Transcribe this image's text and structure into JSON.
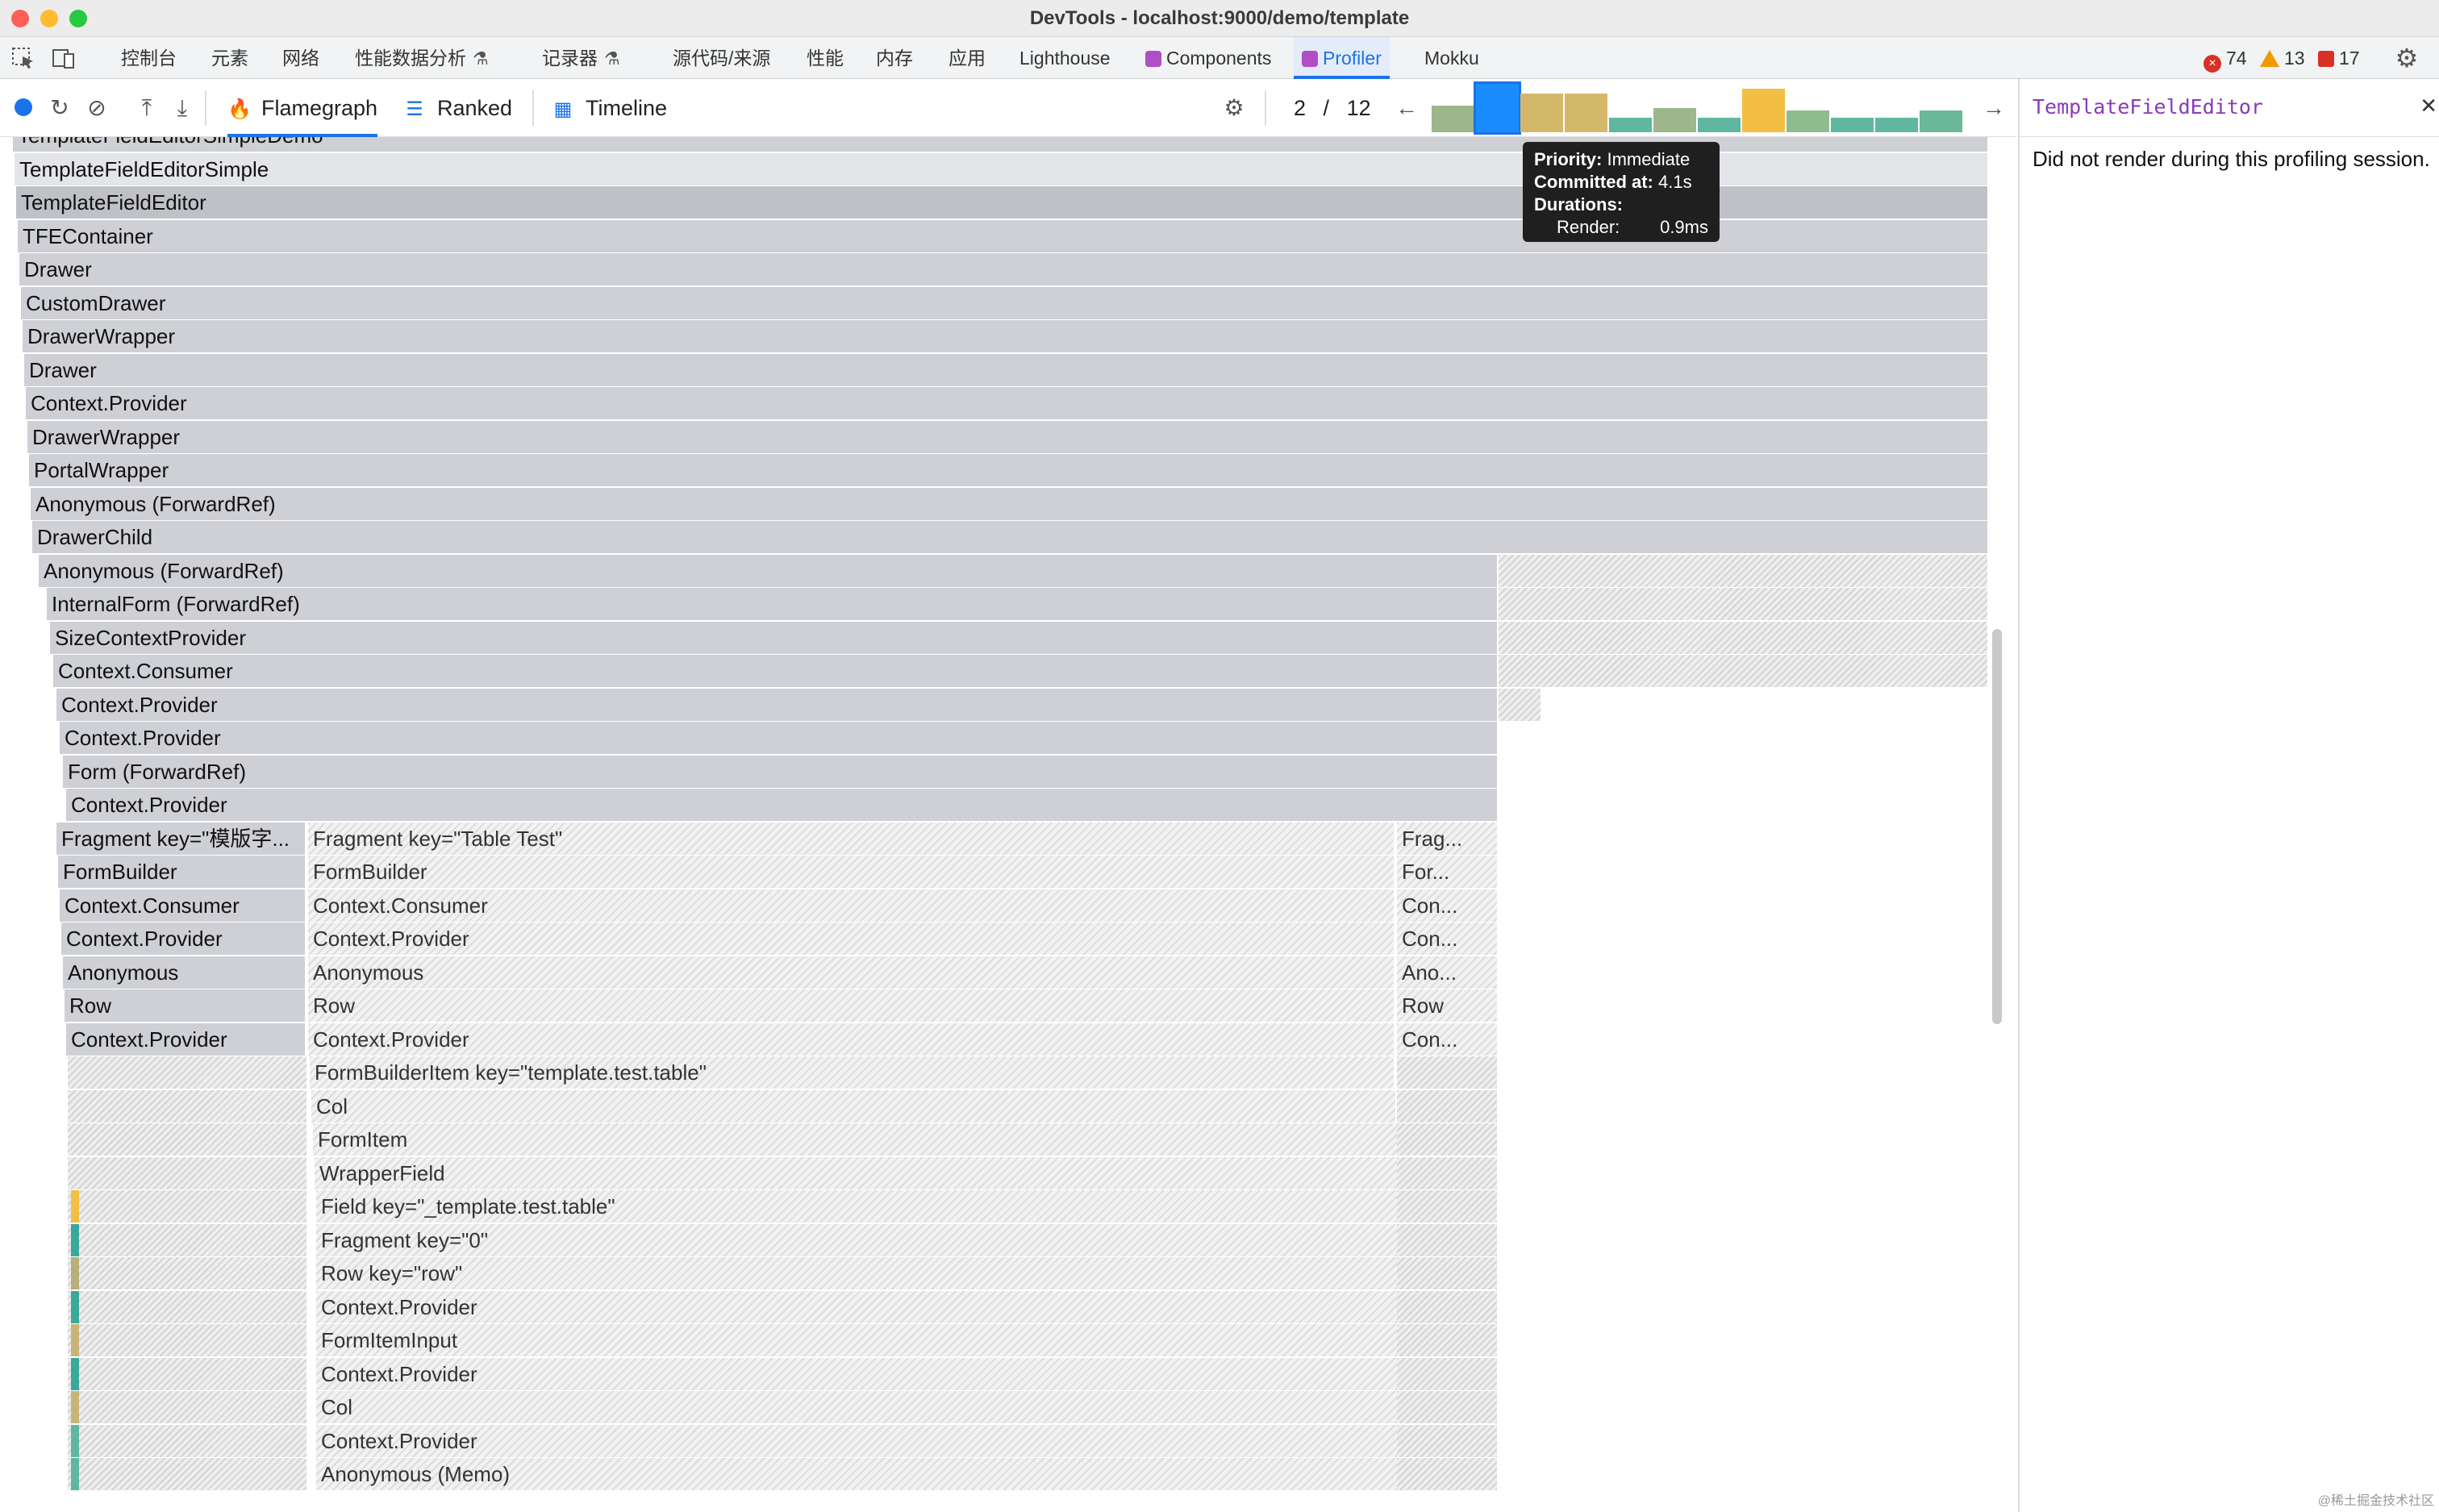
{
  "window": {
    "title": "DevTools - localhost:9000/demo/template"
  },
  "devtools_tabs": [
    {
      "label": "控制台"
    },
    {
      "label": "元素"
    },
    {
      "label": "网络"
    },
    {
      "label": "性能数据分析",
      "flask": "⚗"
    },
    {
      "label": "记录器",
      "flask": "⚗"
    },
    {
      "label": "源代码/来源"
    },
    {
      "label": "性能"
    },
    {
      "label": "内存"
    },
    {
      "label": "应用"
    },
    {
      "label": "Lighthouse"
    },
    {
      "label": "Components"
    },
    {
      "label": "Profiler"
    },
    {
      "label": "Mokku"
    }
  ],
  "counters": {
    "errors": "74",
    "warnings": "13",
    "issues": "17"
  },
  "profiler": {
    "modes": {
      "flamegraph": "Flamegraph",
      "ranked": "Ranked",
      "timeline": "Timeline"
    },
    "commit": {
      "current": "2",
      "separator": "/",
      "total": "12"
    },
    "commit_bars": [
      {
        "h": 0.55,
        "color": "#9db68a"
      },
      {
        "h": 1.0,
        "color": "#1a8cff",
        "selected": true
      },
      {
        "h": 0.8,
        "color": "#d4b86a"
      },
      {
        "h": 0.8,
        "color": "#d4b86a"
      },
      {
        "h": 0.3,
        "color": "#5fb7a0"
      },
      {
        "h": 0.5,
        "color": "#9db68a"
      },
      {
        "h": 0.3,
        "color": "#5fb7a0"
      },
      {
        "h": 0.9,
        "color": "#f2bf44"
      },
      {
        "h": 0.45,
        "color": "#8fbc8f"
      },
      {
        "h": 0.3,
        "color": "#5fb7a0"
      },
      {
        "h": 0.3,
        "color": "#5fb7a0"
      },
      {
        "h": 0.45,
        "color": "#6cb89a"
      }
    ]
  },
  "tooltip": {
    "priority_label": "Priority:",
    "priority_value": "Immediate",
    "committed_label": "Committed at:",
    "committed_value": "4.1s",
    "durations_label": "Durations:",
    "render_label": "Render:",
    "render_value": "0.9ms"
  },
  "side_panel": {
    "title": "TemplateFieldEditor",
    "message": "Did not render during this profiling session."
  },
  "flamegraph": {
    "full_rows": [
      "TemplateFieldEditorSimpleDemo",
      "TemplateFieldEditorSimple",
      "TemplateFieldEditor",
      "TFEContainer",
      "Drawer",
      "CustomDrawer",
      "DrawerWrapper",
      "Drawer",
      "Context.Provider",
      "DrawerWrapper",
      "PortalWrapper",
      "Anonymous (ForwardRef)",
      "DrawerChild"
    ],
    "mid_rows": [
      "Anonymous (ForwardRef)",
      "InternalForm (ForwardRef)",
      "SizeContextProvider",
      "Context.Consumer",
      "Context.Provider",
      "Context.Provider",
      "Form (ForwardRef)",
      "Context.Provider"
    ],
    "split_rows": [
      {
        "a": "Fragment key=\"模版字...",
        "b": "Fragment key=\"Table Test\"",
        "c": "Frag..."
      },
      {
        "a": "FormBuilder",
        "b": "FormBuilder",
        "c": "For..."
      },
      {
        "a": "Context.Consumer",
        "b": "Context.Consumer",
        "c": "Con..."
      },
      {
        "a": "Context.Provider",
        "b": "Context.Provider",
        "c": "Con..."
      },
      {
        "a": "Anonymous",
        "b": "Anonymous",
        "c": "Ano..."
      },
      {
        "a": "Row",
        "b": "Row",
        "c": "Row"
      },
      {
        "a": "Context.Provider",
        "b": "Context.Provider",
        "c": "Con..."
      }
    ],
    "deep_rows": [
      "FormBuilderItem key=\"template.test.table\"",
      "Col",
      "FormItem",
      "WrapperField",
      "Field key=\"_template.test.table\"",
      "Fragment key=\"0\"",
      "Row key=\"row\"",
      "Context.Provider",
      "FormItemInput",
      "Context.Provider",
      "Col",
      "Context.Provider",
      "Anonymous (Memo)"
    ],
    "chip_colors": [
      "",
      "",
      "",
      "",
      "#f2bf44",
      "#3aa89a",
      "#b8b07a",
      "#3aa89a",
      "#c8b477",
      "#3aa89a",
      "#c8b477",
      "#5fb7a0",
      "#5fb7a0"
    ]
  },
  "watermark": "@稀土掘金技术社区"
}
